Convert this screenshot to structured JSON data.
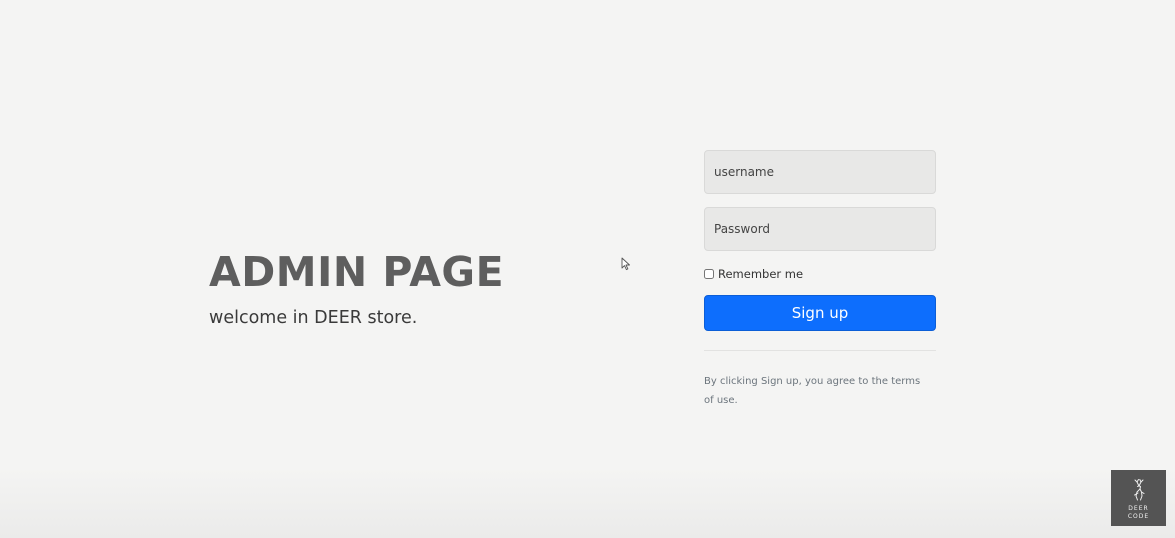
{
  "hero": {
    "title": "ADMIN PAGE",
    "subtitle": "welcome in DEER store."
  },
  "form": {
    "username_placeholder": "username",
    "password_placeholder": "Password",
    "remember_label": "Remember me",
    "remember_checked": false,
    "signup_label": "Sign up",
    "terms_text": "By clicking Sign up, you agree to the terms of use."
  },
  "watermark": {
    "logo_text": "DEER\nCODE",
    "icon": "deer-icon"
  },
  "colors": {
    "background": "#f4f4f3",
    "primary_button": "#0d6efd",
    "title": "#5e5e5e",
    "input_background": "#e8e8e7",
    "logo_background": "#545454"
  }
}
